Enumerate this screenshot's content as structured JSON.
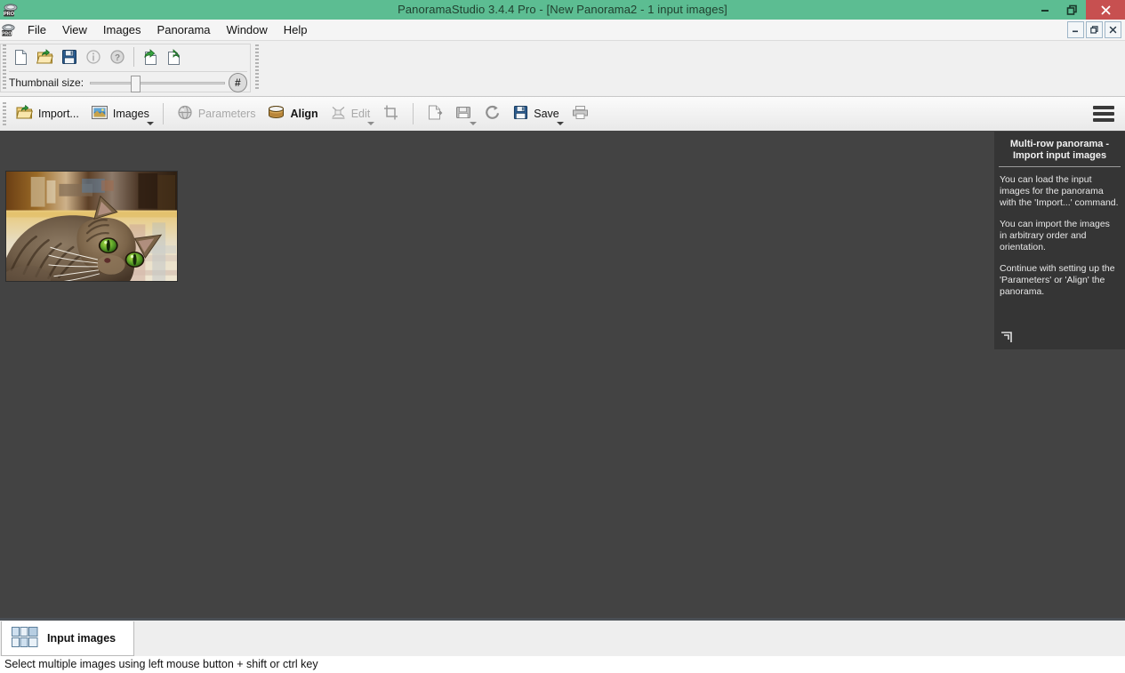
{
  "window": {
    "title": "PanoramaStudio 3.4.4 Pro - [New Panorama2 - 1 input images]",
    "app_icon": "panoramastudio-pro-icon",
    "accent_title_bg": "#5cbd92",
    "close_btn_bg": "#c75050",
    "controls": {
      "minimize": "minimize-icon",
      "restore": "restore-icon",
      "close": "close-icon"
    },
    "mdi_controls": {
      "minimize": "mdi-minimize-icon",
      "restore": "mdi-restore-icon",
      "close": "mdi-close-icon"
    }
  },
  "menubar": {
    "items": [
      {
        "label": "File"
      },
      {
        "label": "View"
      },
      {
        "label": "Images"
      },
      {
        "label": "Panorama"
      },
      {
        "label": "Window"
      },
      {
        "label": "Help"
      }
    ]
  },
  "toolbar_top": {
    "buttons": [
      {
        "name": "new-document-button",
        "icon": "new-document-icon",
        "enabled": true
      },
      {
        "name": "open-folder-button",
        "icon": "open-folder-icon",
        "enabled": true
      },
      {
        "name": "save-button",
        "icon": "floppy-save-icon",
        "enabled": true
      },
      {
        "name": "info-button",
        "icon": "info-icon",
        "enabled": false
      },
      {
        "name": "help-button",
        "icon": "question-help-icon",
        "enabled": false
      },
      {
        "name": "import-images-button",
        "icon": "import-green-arrow-icon",
        "enabled": true
      },
      {
        "name": "export-images-button",
        "icon": "export-green-arrow-icon",
        "enabled": true
      }
    ],
    "thumbnail_size": {
      "label": "Thumbnail size:",
      "value_position_pct": 30,
      "hash_button_glyph": "#"
    }
  },
  "ribbon": {
    "items": [
      {
        "name": "import",
        "label": "Import...",
        "icon": "import-folder-icon",
        "enabled": true,
        "bold": false,
        "caret": false
      },
      {
        "name": "images",
        "label": "Images",
        "icon": "images-picture-icon",
        "enabled": true,
        "bold": false,
        "caret": true
      },
      {
        "name": "separator-1",
        "type": "separator"
      },
      {
        "name": "parameters",
        "label": "Parameters",
        "icon": "parameters-sphere-icon",
        "enabled": false,
        "bold": false,
        "caret": false
      },
      {
        "name": "align",
        "label": "Align",
        "icon": "align-cylinder-icon",
        "enabled": true,
        "bold": true,
        "caret": false
      },
      {
        "name": "edit",
        "label": "Edit",
        "icon": "edit-pen-icon",
        "enabled": false,
        "bold": false,
        "caret": true
      },
      {
        "name": "crop",
        "label": "",
        "icon": "crop-icon",
        "enabled": false,
        "bold": false,
        "caret": false
      },
      {
        "name": "separator-2",
        "type": "separator"
      },
      {
        "name": "export-page",
        "label": "",
        "icon": "export-page-icon",
        "enabled": false,
        "bold": false,
        "caret": false
      },
      {
        "name": "save-image",
        "label": "",
        "icon": "save-image-icon",
        "enabled": false,
        "bold": false,
        "caret": true
      },
      {
        "name": "publish",
        "label": "",
        "icon": "publish-swirl-icon",
        "enabled": false,
        "bold": false,
        "caret": false
      },
      {
        "name": "save",
        "label": "Save",
        "icon": "floppy-save-icon",
        "enabled": true,
        "bold": false,
        "caret": true
      },
      {
        "name": "print",
        "label": "",
        "icon": "printer-icon",
        "enabled": false,
        "bold": false,
        "caret": false
      }
    ],
    "menu_button": "hamburger-menu-icon"
  },
  "workspace": {
    "background": "#434343",
    "thumbnails": [
      {
        "name": "input-image-thumbnail",
        "alt": "cat lying on blanket"
      }
    ]
  },
  "help_panel": {
    "title_line1": "Multi-row panorama -",
    "title_line2": "Import input images",
    "paragraphs": [
      "You can load the input images for the panorama with the 'Import...' command.",
      "You can import the images in arbitrary order and orientation.",
      "Continue with setting up the 'Parameters' or 'Align' the panorama."
    ],
    "resize_handle": "resize-handle-icon",
    "background": "#353535"
  },
  "tabstrip": {
    "tabs": [
      {
        "name": "input-images",
        "label": "Input images",
        "icon": "grid-tiles-icon",
        "active": true
      }
    ]
  },
  "statusbar": {
    "text": "Select multiple images using left mouse button + shift or ctrl key"
  }
}
